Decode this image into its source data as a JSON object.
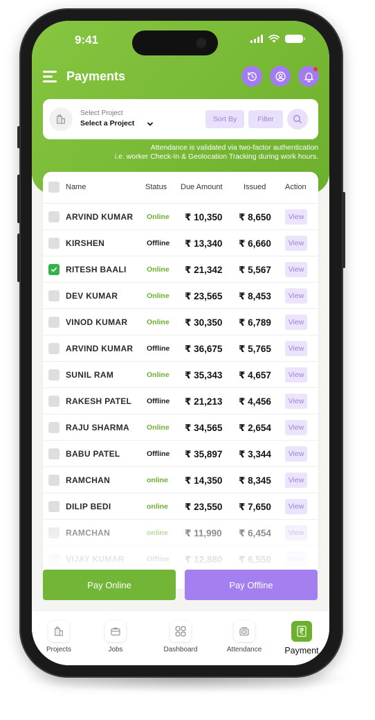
{
  "status_bar": {
    "time": "9:41"
  },
  "header": {
    "title": "Payments"
  },
  "filter": {
    "project_label": "Select Project",
    "project_value": "Select a Project",
    "sort_label": "Sort By",
    "filter_label": "Filter"
  },
  "notice": {
    "line1": "Attendance is validated via two-factor authentication",
    "line2": "i.e. worker Check-In & Geolocation Tracking during work hours."
  },
  "table": {
    "headers": {
      "name": "Name",
      "status": "Status",
      "due": "Due Amount",
      "issued": "Issued",
      "action": "Action"
    },
    "view_label": "View",
    "rows": [
      {
        "name": "ARVIND KUMAR",
        "status": "Online",
        "due": "₹ 10,350",
        "issued": "₹ 8,650",
        "checked": false
      },
      {
        "name": "KIRSHEN",
        "status": "Offline",
        "due": "₹ 13,340",
        "issued": "₹ 6,660",
        "checked": false
      },
      {
        "name": "RITESH BAALI",
        "status": "Online",
        "due": "₹ 21,342",
        "issued": "₹ 5,567",
        "checked": true
      },
      {
        "name": "DEV KUMAR",
        "status": "Online",
        "due": "₹ 23,565",
        "issued": "₹ 8,453",
        "checked": false
      },
      {
        "name": "VINOD KUMAR",
        "status": "Online",
        "due": "₹ 30,350",
        "issued": "₹ 6,789",
        "checked": false
      },
      {
        "name": "ARVIND KUMAR",
        "status": "Offline",
        "due": "₹ 36,675",
        "issued": "₹ 5,765",
        "checked": false
      },
      {
        "name": "SUNIL RAM",
        "status": "Online",
        "due": "₹ 35,343",
        "issued": "₹ 4,657",
        "checked": false
      },
      {
        "name": "RAKESH PATEL",
        "status": "Offline",
        "due": "₹ 21,213",
        "issued": "₹ 4,456",
        "checked": false
      },
      {
        "name": "RAJU SHARMA",
        "status": "Online",
        "due": "₹ 34,565",
        "issued": "₹ 2,654",
        "checked": false
      },
      {
        "name": "BABU PATEL",
        "status": "Offline",
        "due": "₹ 35,897",
        "issued": "₹ 3,344",
        "checked": false
      },
      {
        "name": "RAMCHAN",
        "status": "online",
        "due": "₹ 14,350",
        "issued": "₹ 8,345",
        "checked": false
      },
      {
        "name": "DILIP BEDI",
        "status": "online",
        "due": "₹ 23,550",
        "issued": "₹ 7,650",
        "checked": false
      },
      {
        "name": "RAMCHAN",
        "status": "online",
        "due": "₹ 11,990",
        "issued": "₹ 6,454",
        "checked": false
      },
      {
        "name": "VIJAY KUMAR",
        "status": "Offline",
        "due": "₹ 12,880",
        "issued": "₹ 6,550",
        "checked": false
      }
    ]
  },
  "actions": {
    "pay_online": "Pay Online",
    "pay_offline": "Pay Offline"
  },
  "nav": {
    "items": [
      {
        "label": "Projects",
        "icon": "building-icon"
      },
      {
        "label": "Jobs",
        "icon": "briefcase-icon"
      },
      {
        "label": "Dashboard",
        "icon": "grid-icon"
      },
      {
        "label": "Attendance",
        "icon": "attendance-icon"
      },
      {
        "label": "Payment",
        "icon": "rupee-icon",
        "active": true
      }
    ]
  },
  "colors": {
    "primary_green": "#73b536",
    "accent_purple": "#a47ff0",
    "online": "#6db02d",
    "alert": "#e53935"
  }
}
